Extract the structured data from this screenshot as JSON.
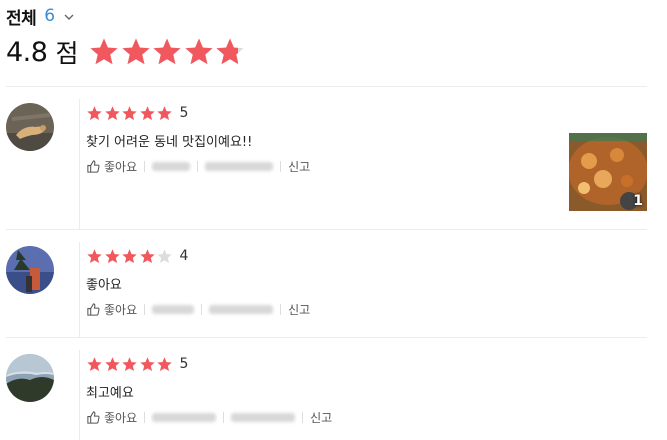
{
  "filter": {
    "label": "전체",
    "count": "6"
  },
  "summary": {
    "score": "4.8",
    "unit": "점",
    "rating": 4.8,
    "max_rating": 5
  },
  "colors": {
    "star_filled": "#f0585e",
    "star_empty": "#dddddd",
    "count_blue": "#3d8bd9"
  },
  "reviews": [
    {
      "rating": 5,
      "rating_text": "5",
      "text": "찾기 어려운 동네 맛집이예요!!",
      "like_label": "좋아요",
      "report_label": "신고",
      "photo_count": "1"
    },
    {
      "rating": 4,
      "rating_text": "4",
      "text": "좋아요",
      "like_label": "좋아요",
      "report_label": "신고"
    },
    {
      "rating": 5,
      "rating_text": "5",
      "text": "최고예요",
      "like_label": "좋아요",
      "report_label": "신고"
    }
  ]
}
